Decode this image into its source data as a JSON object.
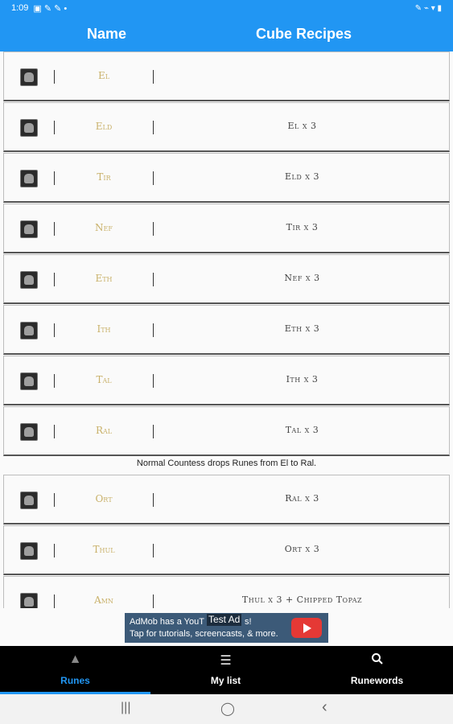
{
  "status_bar": {
    "time": "1:09",
    "left_icons": "▣ ✎ ✎ •",
    "right_icons": "✎ ⌁ ▾ ▮"
  },
  "header": {
    "name_label": "Name",
    "recipe_label": "Cube Recipes"
  },
  "runes": [
    {
      "name": "El",
      "recipe": ""
    },
    {
      "name": "Eld",
      "recipe": "El x 3"
    },
    {
      "name": "Tir",
      "recipe": "Eld x 3"
    },
    {
      "name": "Nef",
      "recipe": "Tir x 3"
    },
    {
      "name": "Eth",
      "recipe": "Nef x 3"
    },
    {
      "name": "Ith",
      "recipe": "Eth x 3"
    },
    {
      "name": "Tal",
      "recipe": "Ith x 3"
    },
    {
      "name": "Ral",
      "recipe": "Tal x 3"
    },
    {
      "name": "Ort",
      "recipe": "Ral x 3"
    },
    {
      "name": "Thul",
      "recipe": "Ort x 3"
    },
    {
      "name": "Amn",
      "recipe": "Thul x 3 + Chipped Topaz"
    }
  ],
  "section_note": "Normal Countess drops Runes from El to Ral.",
  "ad": {
    "line1": "AdMob has a YouT",
    "line1_end": "s!",
    "line2": "Tap for tutorials, screencasts, & more.",
    "test_label": "Test Ad"
  },
  "bottom_nav": [
    {
      "label": "Runes",
      "icon": "rune-icon",
      "active": true
    },
    {
      "label": "My list",
      "icon": "list-icon",
      "active": false
    },
    {
      "label": "Runewords",
      "icon": "search-icon",
      "active": false
    }
  ],
  "system_nav": {
    "recents": "|||",
    "home": "◯",
    "back": "‹"
  }
}
